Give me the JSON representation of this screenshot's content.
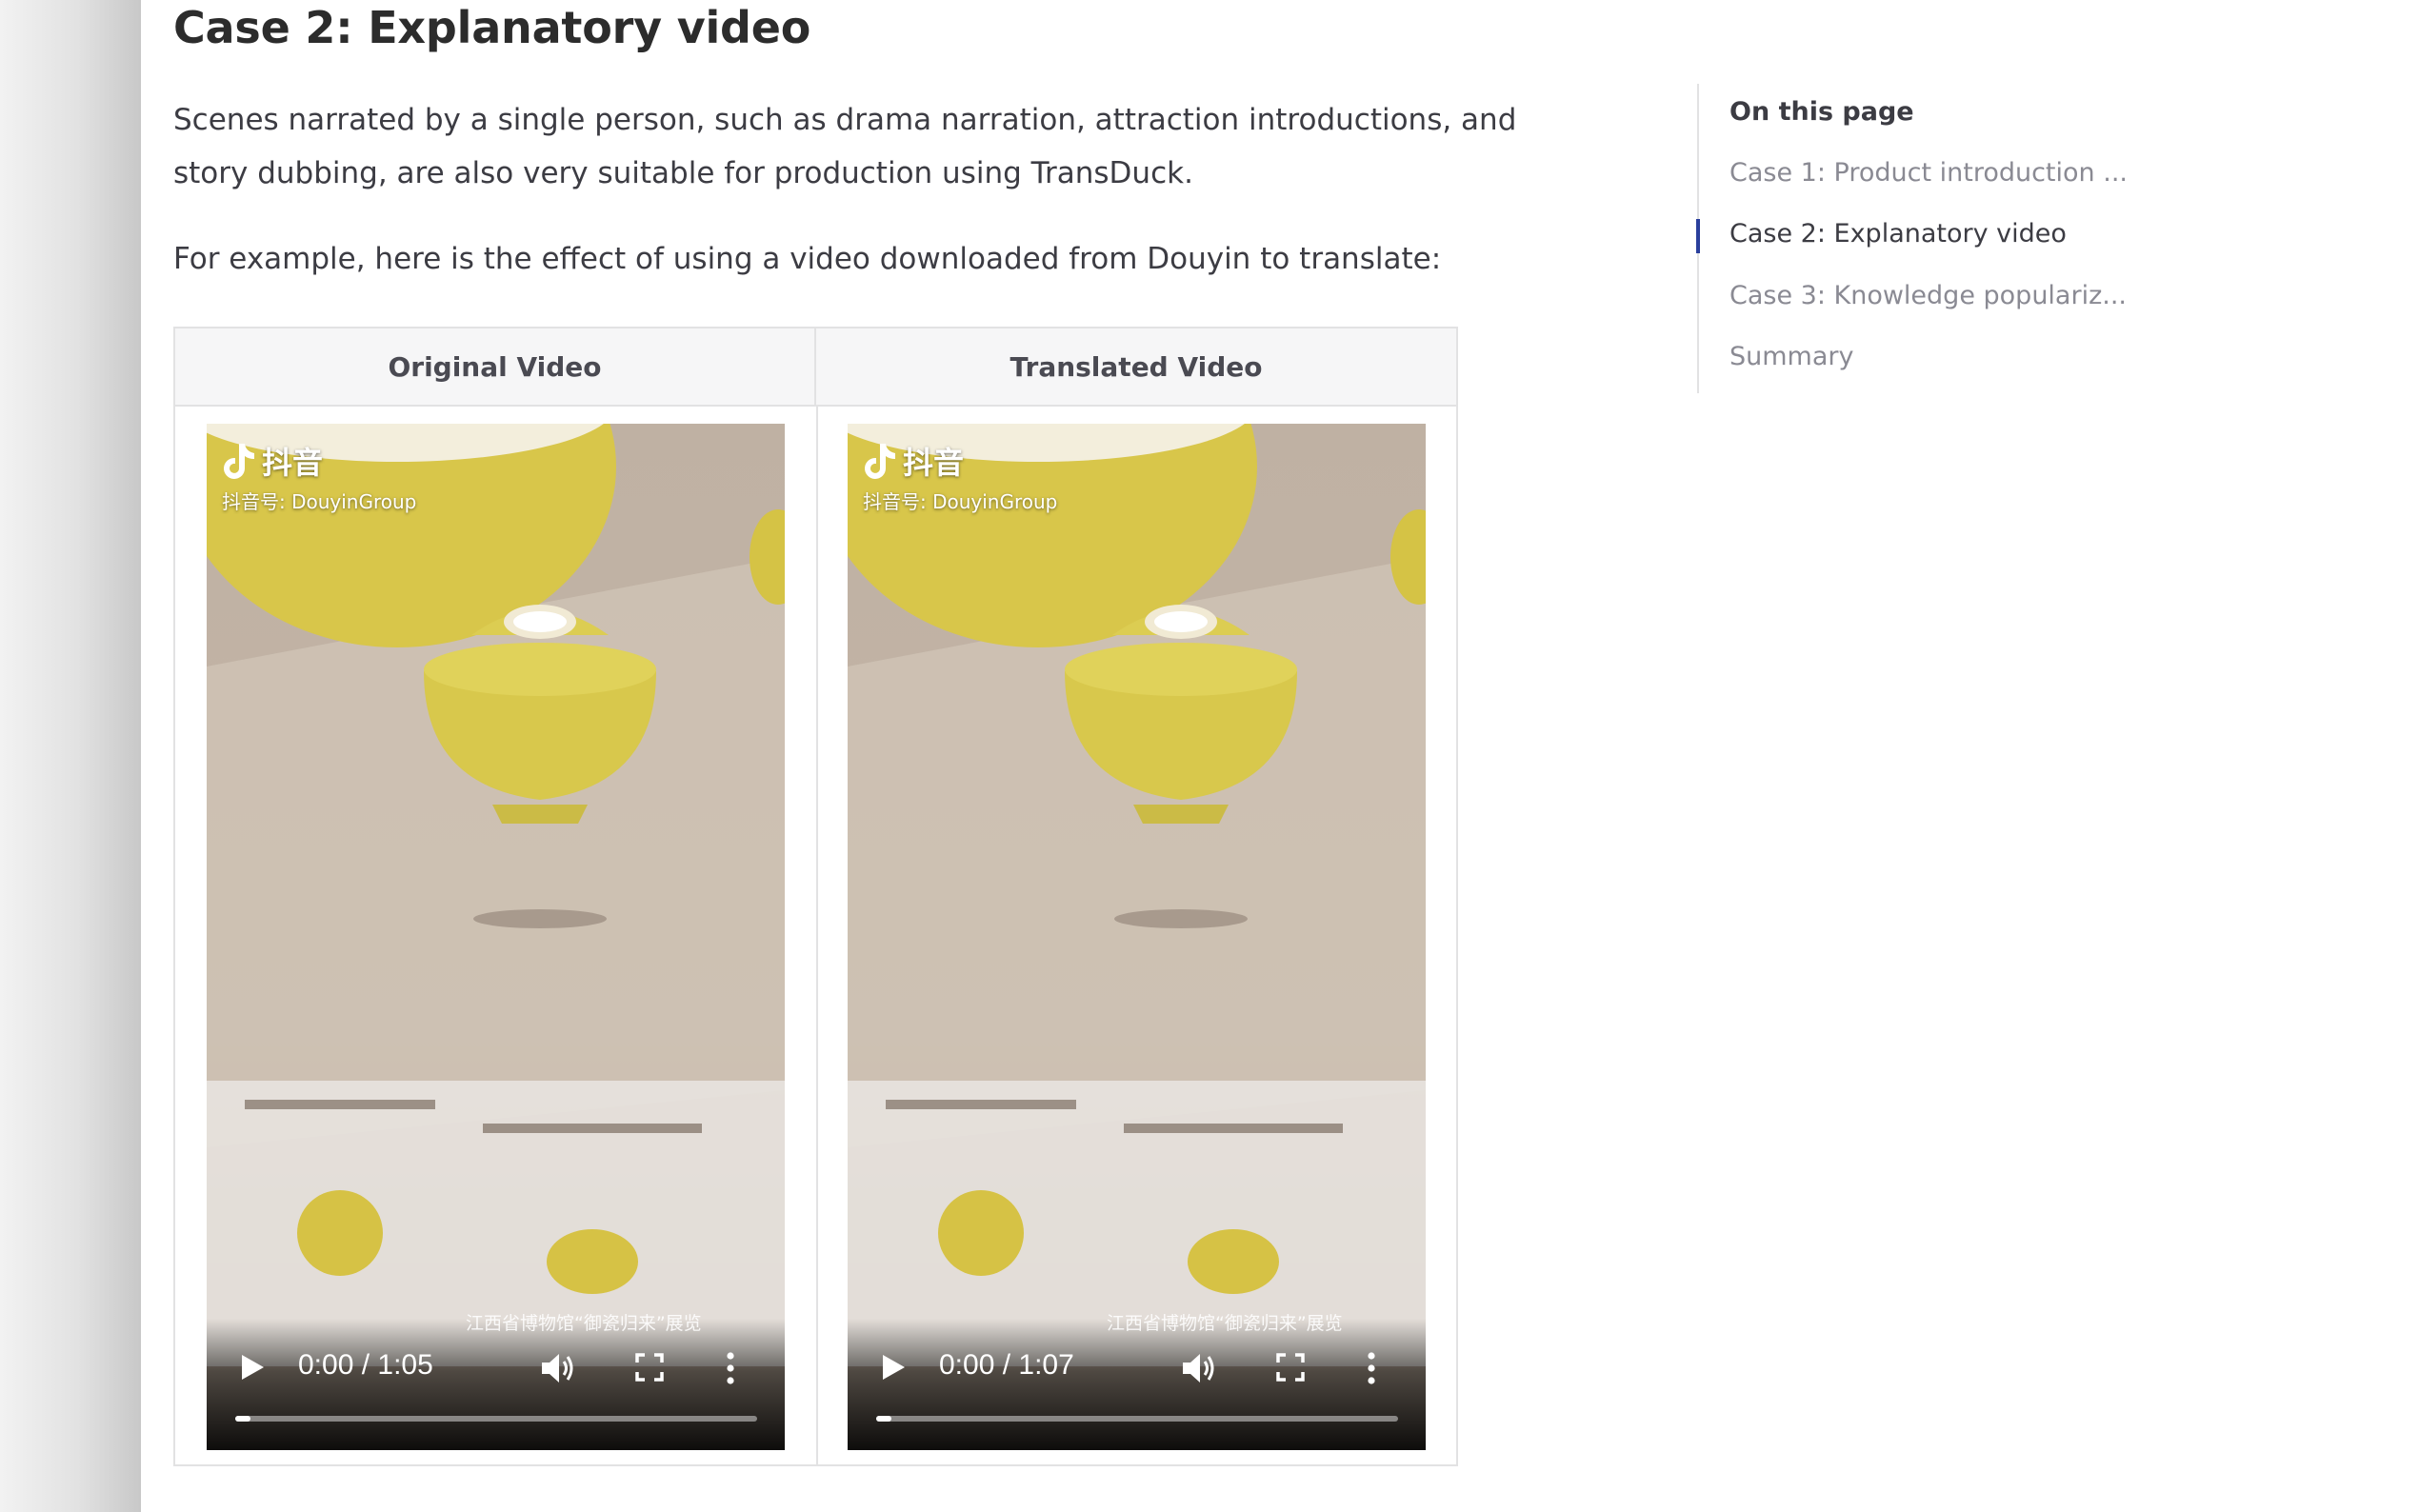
{
  "heading": "Case 2: Explanatory video",
  "paragraphs": {
    "p1_line1": "Scenes narrated by a single person, such as drama narration, attraction introductions, and",
    "p1_line2": "story dubbing, are also very suitable for production using TransDuck.",
    "p2": "For example, here is the effect of using a video downloaded from Douyin to translate:"
  },
  "table": {
    "headers": [
      "Original Video",
      "Translated Video"
    ],
    "videos": [
      {
        "watermark_brand": "抖音",
        "watermark_id": "抖音号: DouyinGroup",
        "caption": "江西省博物馆“御瓷归来”展览",
        "time": "0:00 / 1:05",
        "progress": 0.03
      },
      {
        "watermark_brand": "抖音",
        "watermark_id": "抖音号: DouyinGroup",
        "caption": "江西省博物馆“御瓷归来”展览",
        "time": "0:00 / 1:07",
        "progress": 0.03
      }
    ]
  },
  "toc": {
    "title": "On this page",
    "items": [
      {
        "label": "Case 1: Product introduction ...",
        "active": false
      },
      {
        "label": "Case 2: Explanatory video",
        "active": true
      },
      {
        "label": "Case 3: Knowledge populariz...",
        "active": false
      },
      {
        "label": "Summary",
        "active": false
      }
    ]
  },
  "colors": {
    "accent": "#2a3f9c",
    "text": "#3c3c43",
    "muted": "#8a8a93",
    "border": "#e2e2e3",
    "header_bg": "#f6f6f7"
  },
  "icons": [
    "douyin-logo-icon",
    "play-icon",
    "volume-icon",
    "fullscreen-icon",
    "more-vert-icon"
  ]
}
